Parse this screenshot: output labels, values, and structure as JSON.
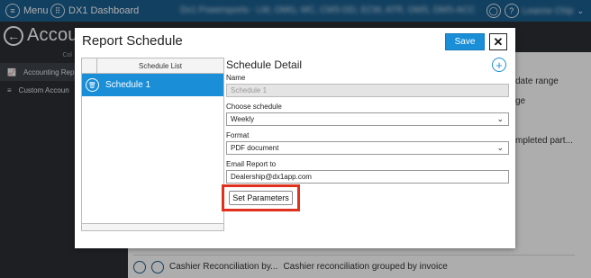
{
  "topbar": {
    "menu_label": "Menu",
    "app_label": "DX1 Dashboard",
    "blurred_dealers": "Dx1 Powersports - LM, OMG, MC, CMS-DD, ECM, ATR, OMS, DMS-ACC",
    "user_name": "Leanne Chip"
  },
  "page": {
    "title": "Accoun"
  },
  "sidebar": {
    "column_header": "Col",
    "items": [
      {
        "label": "Accounting Rep"
      },
      {
        "label": "Custom Accoun"
      }
    ]
  },
  "background_rows": [
    "date range",
    "ge",
    "mpleted part..."
  ],
  "background_bottom": {
    "name": "Cashier Reconciliation by...",
    "desc": "Cashier reconciliation grouped by invoice"
  },
  "dialog": {
    "title": "Report Schedule",
    "save_label": "Save",
    "close_label": "✕",
    "list_header": "Schedule List",
    "list_items": [
      {
        "label": "Schedule 1"
      }
    ],
    "detail_title": "Schedule Detail",
    "name_label": "Name",
    "name_placeholder": "Schedule 1",
    "schedule_label": "Choose schedule",
    "schedule_value": "Weekly",
    "format_label": "Format",
    "format_value": "PDF document",
    "email_label": "Email Report to",
    "email_value": "Dealership@dx1app.com",
    "set_params_label": "Set Parameters"
  },
  "colors": {
    "accent": "#1a8fd8",
    "topbar": "#1b5f8f",
    "highlight": "#e0301e"
  }
}
